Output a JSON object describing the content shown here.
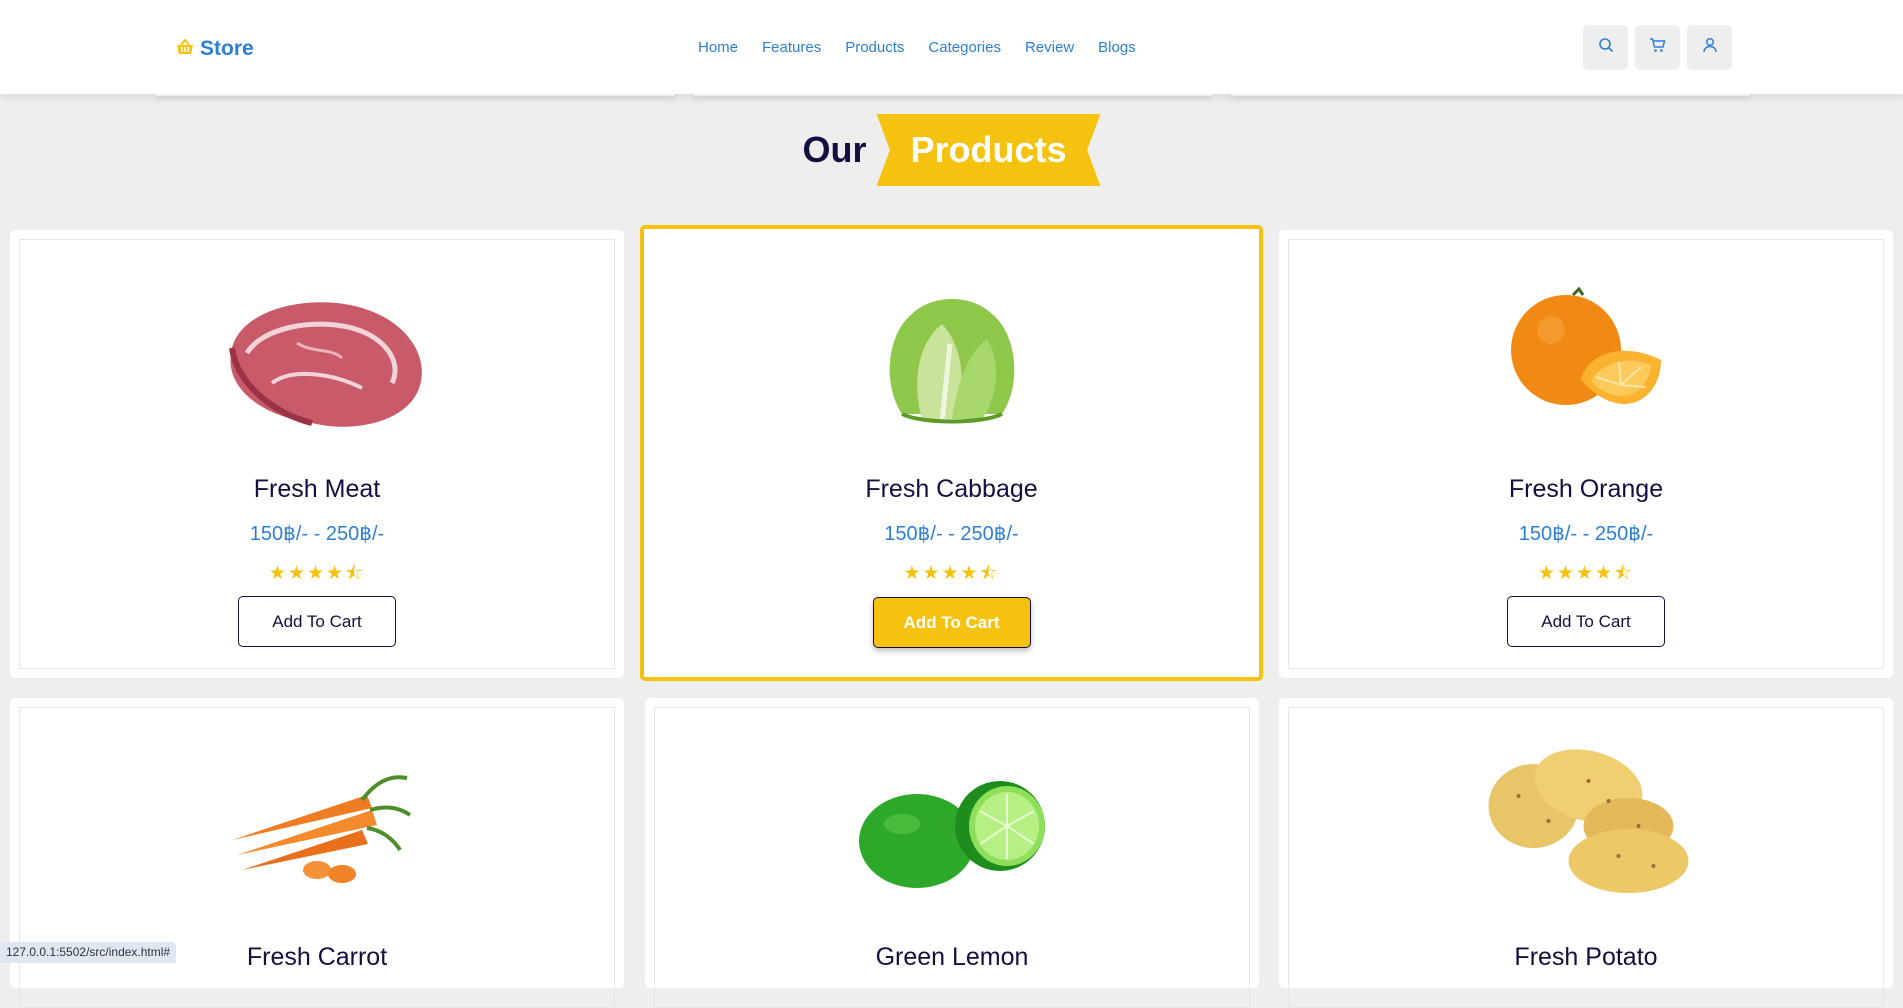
{
  "header": {
    "logo_text": "Store",
    "nav": [
      "Home",
      "Features",
      "Products",
      "Categories",
      "Review",
      "Blogs"
    ],
    "icons": [
      "search-icon",
      "cart-icon",
      "user-icon"
    ]
  },
  "section": {
    "heading_plain": "Our",
    "heading_highlight": "Products"
  },
  "products": [
    {
      "name": "Fresh Meat",
      "price": "150฿/- - 250฿/-",
      "rating": 4.5,
      "button": "Add To Cart",
      "image": "meat"
    },
    {
      "name": "Fresh Cabbage",
      "price": "150฿/- - 250฿/-",
      "rating": 4.5,
      "button": "Add To Cart",
      "image": "cabbage"
    },
    {
      "name": "Fresh Orange",
      "price": "150฿/- - 250฿/-",
      "rating": 4.5,
      "button": "Add To Cart",
      "image": "orange"
    },
    {
      "name": "Fresh Carrot",
      "image": "carrot"
    },
    {
      "name": "Green Lemon",
      "image": "lemon"
    },
    {
      "name": "Fresh Potato",
      "image": "potato"
    }
  ],
  "status_url": "127.0.0.1:5502/src/index.html#",
  "colors": {
    "accent": "#f5c210",
    "link": "#2d7fd3",
    "text": "#130f40"
  }
}
